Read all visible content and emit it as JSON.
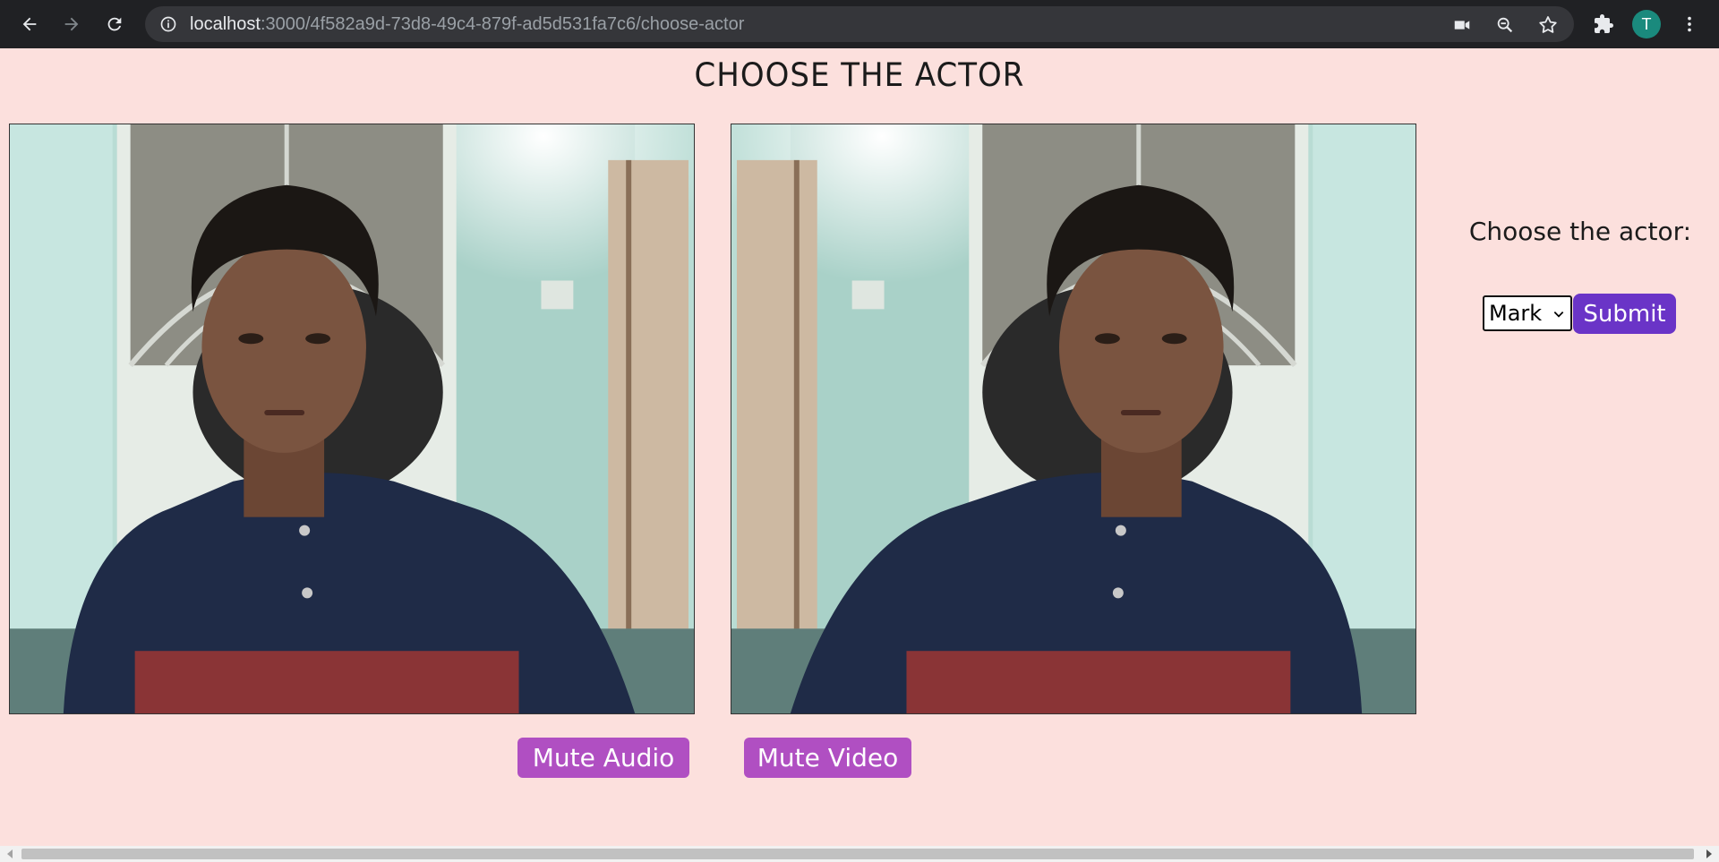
{
  "browser": {
    "url_host": "localhost",
    "url_rest": ":3000/4f582a9d-73d8-49c4-879f-ad5d531fa7c6/choose-actor",
    "profile_initial": "T",
    "icons": [
      "back-icon",
      "forward-icon",
      "reload-icon",
      "info-icon",
      "camera-icon",
      "zoom-icon",
      "star-icon",
      "extensions-icon",
      "menu-icon"
    ]
  },
  "page": {
    "title": "CHOOSE THE ACTOR",
    "mute_audio_label": "Mute Audio",
    "mute_video_label": "Mute Video",
    "choose_label": "Choose the actor:",
    "actor_selected": "Mark",
    "submit_label": "Submit"
  },
  "colors": {
    "page_bg": "#fce0dd",
    "mute_button": "#b04fc2",
    "submit_button": "#6a34c7",
    "chrome_bg": "#202124"
  }
}
